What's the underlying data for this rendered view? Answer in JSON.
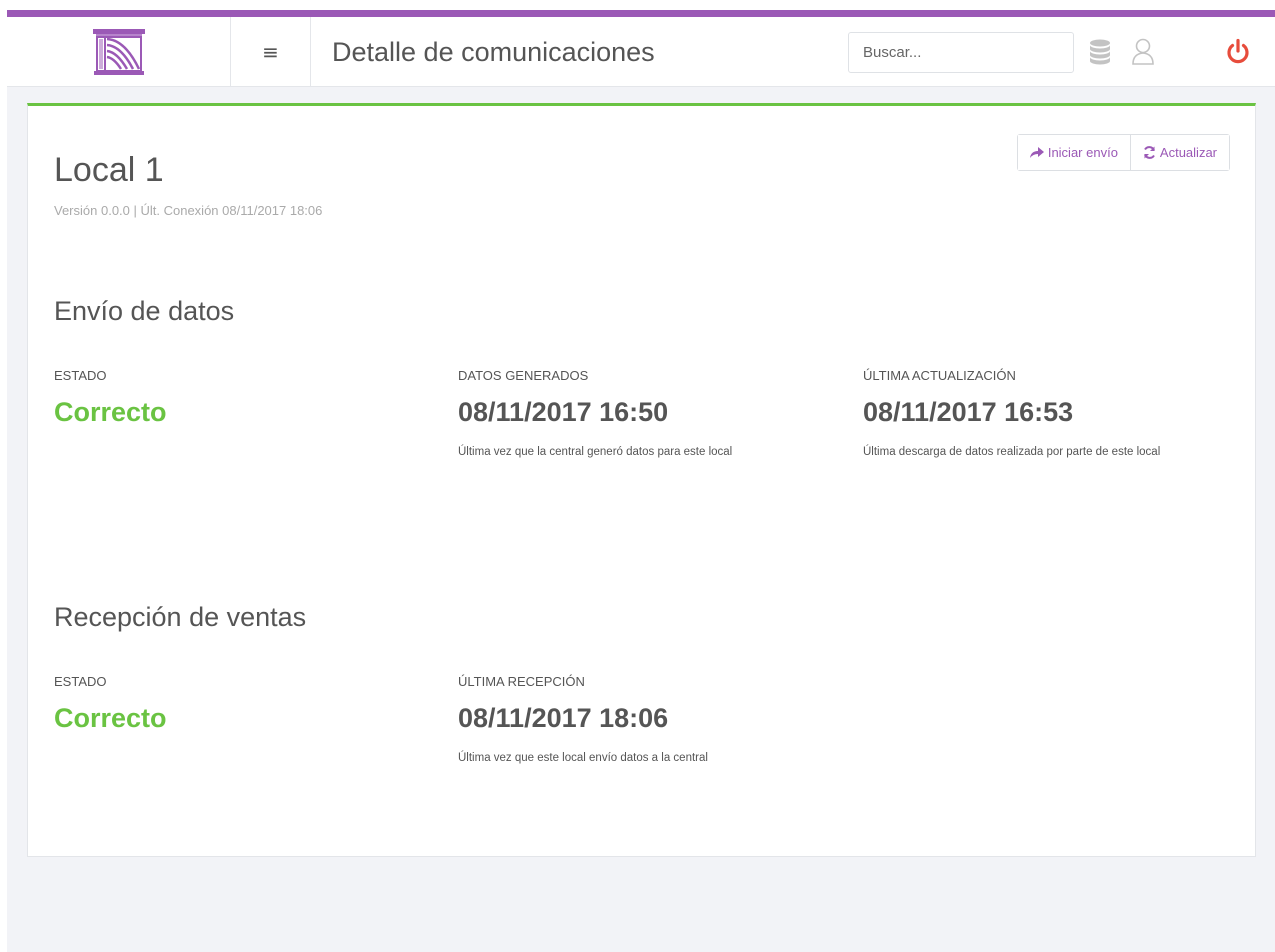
{
  "colors": {
    "accent": "#9b59b6",
    "ok": "#6ac342",
    "power": "#e74c3c"
  },
  "header": {
    "logo_icon": "castle-gate-logo",
    "menu_icon": "hamburger-icon",
    "menu_glyph": "≡",
    "title": "Detalle de comunicaciones",
    "search_placeholder": "Buscar...",
    "icons": [
      "database-icon",
      "user-icon",
      "power-icon"
    ]
  },
  "local": {
    "name": "Local 1",
    "subtitle": "Versión 0.0.0 | Últ. Conexión 08/11/2017 18:06",
    "actions": {
      "send_label": "Iniciar envío",
      "refresh_label": "Actualizar"
    }
  },
  "envio": {
    "title": "Envío de datos",
    "estado": {
      "label": "ESTADO",
      "value": "Correcto"
    },
    "generados": {
      "label": "DATOS GENERADOS",
      "value": "08/11/2017 16:50",
      "desc": "Última vez que la central generó datos para este local"
    },
    "actualizacion": {
      "label": "ÚLTIMA ACTUALIZACIÓN",
      "value": "08/11/2017 16:53",
      "desc": "Última descarga de datos realizada por parte de este local"
    }
  },
  "recepcion": {
    "title": "Recepción de ventas",
    "estado": {
      "label": "ESTADO",
      "value": "Correcto"
    },
    "ultima": {
      "label": "ÚLTIMA RECEPCIÓN",
      "value": "08/11/2017 18:06",
      "desc": "Última vez que este local envío datos a la central"
    }
  }
}
